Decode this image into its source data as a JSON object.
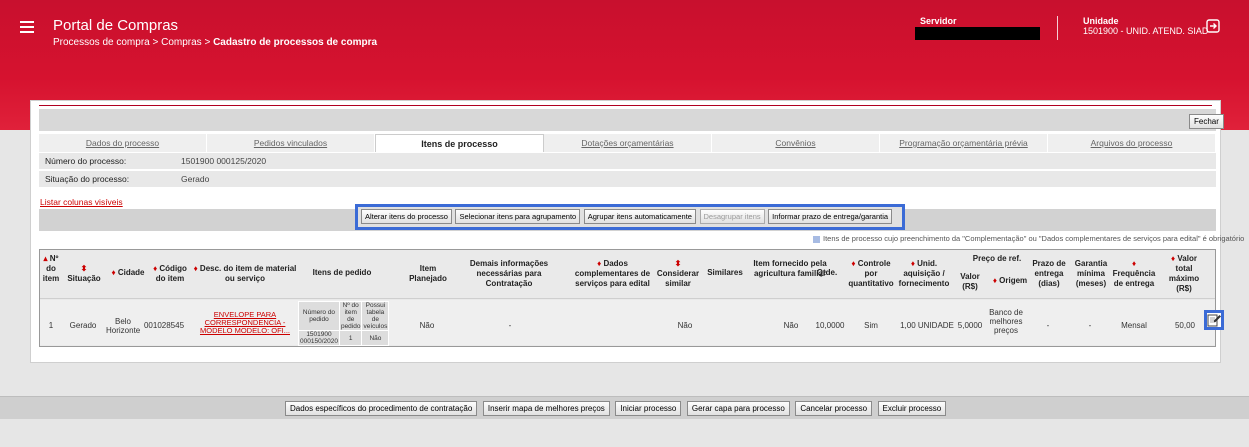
{
  "header": {
    "title": "Portal de Compras",
    "breadcrumb_prefix": "Processos de compra > Compras > ",
    "breadcrumb_current": "Cadastro de processos de compra",
    "servidor_label": "Servidor",
    "unidade_label": "Unidade",
    "unidade_value": "1501900 - UNID. ATEND. SIAD"
  },
  "fechar_label": "Fechar",
  "tabs": [
    {
      "label": "Dados do processo"
    },
    {
      "label": "Pedidos vinculados"
    },
    {
      "label": "Itens de processo"
    },
    {
      "label": "Dotações orçamentárias"
    },
    {
      "label": "Convênios"
    },
    {
      "label": "Programação orçamentária prévia"
    },
    {
      "label": "Arquivos do processo"
    }
  ],
  "info": {
    "numero_label": "Número do processo:",
    "numero_value": "1501900 000125/2020",
    "situacao_label": "Situação do processo:",
    "situacao_value": "Gerado"
  },
  "listar_colunas": "Listar colunas visíveis",
  "actions": {
    "alterar": "Alterar itens do processo",
    "selecionar": "Selecionar itens para agrupamento",
    "agrupar": "Agrupar itens automaticamente",
    "desagrupar": "Desagrupar itens",
    "informar": "Informar prazo de entrega/garantia"
  },
  "legend_text": "Itens de processo cujo preenchimento da \"Complementação\" ou \"Dados complementares de serviços para edital\" é obrigatório",
  "table": {
    "headers": {
      "n_item": "Nº do item",
      "situacao": "Situação",
      "cidade": "Cidade",
      "codigo": "Código do item",
      "desc": "Desc. do item de material ou serviço",
      "itens_pedido": "Itens de pedido",
      "item_planejado": "Item Planejado",
      "demais_info": "Demais informações necessárias para Contratação",
      "dados_compl": "Dados complementares de serviços para edital",
      "considerar": "Considerar similar",
      "similares": "Similares",
      "item_fornecido": "Item fornecido pela agricultura familiar",
      "qtde": "Qtde.",
      "controle": "Controle por quantitativo",
      "unid": "Unid. aquisição / fornecimento",
      "preco_ref": "Preço de ref.",
      "valor": "Valor (R$)",
      "origem": "Origem",
      "prazo": "Prazo de entrega (dias)",
      "garantia": "Garantia mínima (meses)",
      "frequencia": "Frequência de entrega",
      "valor_total": "Valor total máximo (R$)"
    },
    "sub_headers": {
      "numero_pedido": "Número do pedido",
      "n_item_pedido": "Nº do item de pedido",
      "possui_tabela": "Possui tabela de veículos"
    },
    "row": {
      "n_item": "1",
      "situacao": "Gerado",
      "cidade": "Belo Horizonte",
      "codigo": "001028545",
      "desc": "ENVELOPE PARA CORRESPONDENCIA - MODELO MODELO: OFI...",
      "numero_pedido": "1501900 000150/2020",
      "n_item_pedido": "1",
      "possui_tabela": "Não",
      "item_planejado": "Não",
      "demais_info": "-",
      "considerar": "Não",
      "item_fornecido": "Não",
      "qtde": "10,0000",
      "controle": "Sim",
      "unid": "1,00 UNIDADE",
      "valor": "5,0000",
      "origem": "Banco de melhores preços",
      "prazo": "-",
      "garantia": "-",
      "frequencia": "Mensal",
      "valor_total": "50,00"
    }
  },
  "footer": {
    "dados_especificos": "Dados específicos do procedimento de contratação",
    "inserir_mapa": "Inserir mapa de melhores preços",
    "iniciar": "Iniciar processo",
    "gerar_capa": "Gerar capa para processo",
    "cancelar": "Cancelar processo",
    "excluir": "Excluir processo"
  },
  "colors": {
    "brand_red": "#c8102e",
    "highlight_blue": "#3b6bd6"
  },
  "icons": [
    "menu-icon",
    "exit-icon",
    "edit-icon",
    "sort-icon"
  ]
}
